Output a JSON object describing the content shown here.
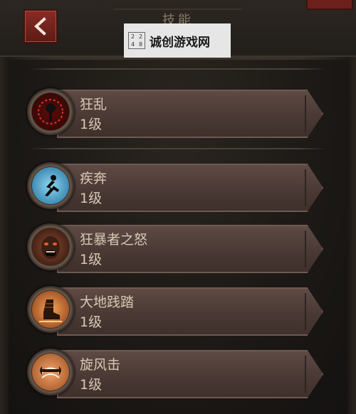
{
  "header": {
    "title": "技能",
    "back_label": "<"
  },
  "watermark": {
    "text": "诚创游戏网",
    "logo_cells": [
      "2",
      "2",
      "4",
      "8"
    ]
  },
  "skills": [
    {
      "name": "狂乱",
      "level": "1级",
      "icon": "frenzy-axe-icon",
      "color": "#b8231c"
    },
    {
      "name": "疾奔",
      "level": "1级",
      "icon": "sprint-runner-icon",
      "color": "#3fa8d8"
    },
    {
      "name": "狂暴者之怒",
      "level": "1级",
      "icon": "berserker-rage-icon",
      "color": "#7a2f1c"
    },
    {
      "name": "大地践踏",
      "level": "1级",
      "icon": "ground-stomp-boot-icon",
      "color": "#d86a2a"
    },
    {
      "name": "旋风击",
      "level": "1级",
      "icon": "whirlwind-axe-icon",
      "color": "#d47a3c"
    }
  ]
}
